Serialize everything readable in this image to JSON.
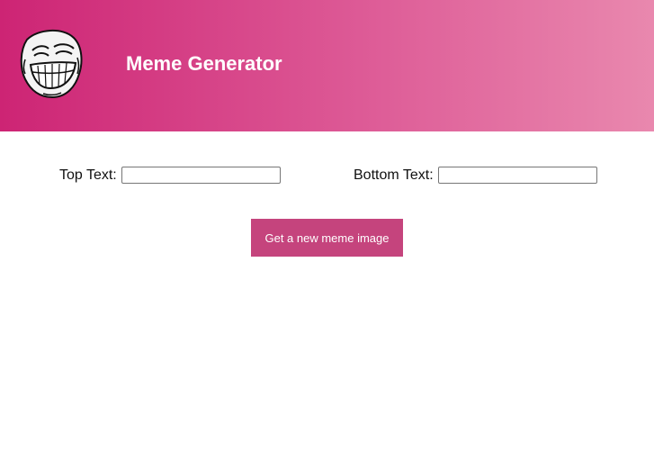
{
  "header": {
    "title": "Meme Generator",
    "logo_icon": "troll-face-icon",
    "gradient_colors": [
      "#cd2474",
      "#dd5a96",
      "#e988ae"
    ]
  },
  "form": {
    "top_text_label": "Top Text:",
    "top_text_value": "",
    "top_text_placeholder": "",
    "bottom_text_label": "Bottom Text:",
    "bottom_text_value": "",
    "bottom_text_placeholder": "",
    "submit_label": "Get a new meme image",
    "submit_color": "#c5447d"
  }
}
